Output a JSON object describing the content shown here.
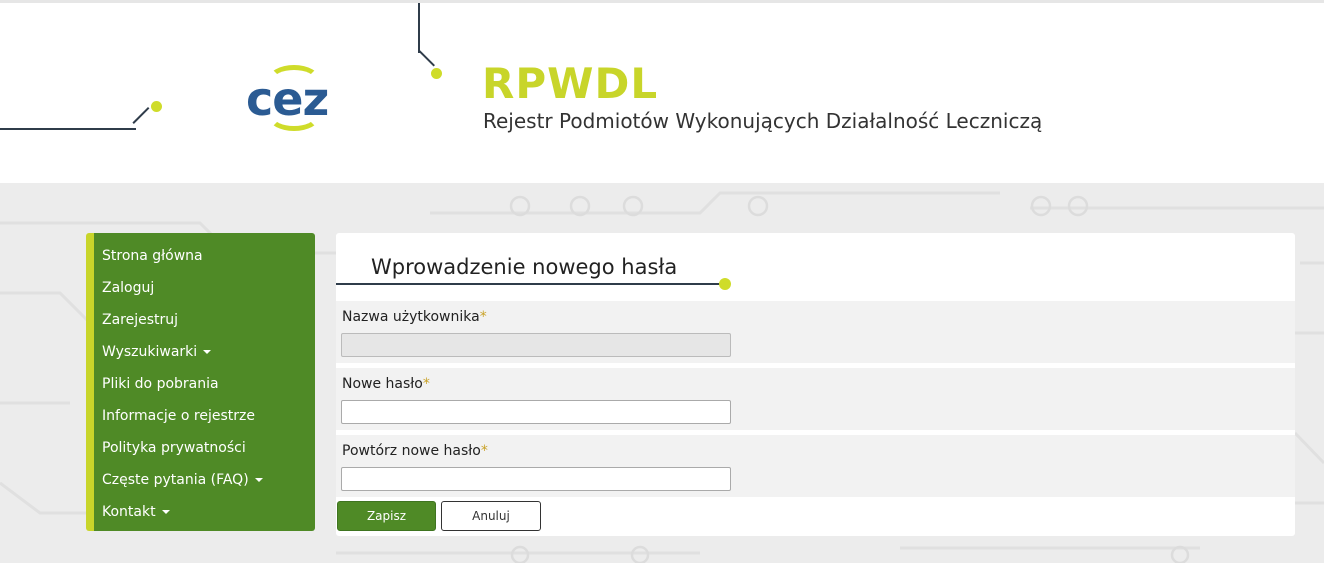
{
  "header": {
    "logo_text": "cez",
    "brand_title": "RPWDL",
    "brand_subtitle": "Rejestr Podmiotów Wykonujących Działalność Leczniczą"
  },
  "colors": {
    "accent_green": "#4f8a26",
    "accent_lime": "#c8d52a",
    "logo_blue": "#2b5b93",
    "required_star": "#c9a227"
  },
  "sidebar": {
    "items": [
      {
        "label": "Strona główna",
        "has_caret": false
      },
      {
        "label": "Zaloguj",
        "has_caret": false
      },
      {
        "label": "Zarejestruj",
        "has_caret": false
      },
      {
        "label": "Wyszukiwarki",
        "has_caret": true
      },
      {
        "label": "Pliki do pobrania",
        "has_caret": false
      },
      {
        "label": "Informacje o rejestrze",
        "has_caret": false
      },
      {
        "label": "Polityka prywatności",
        "has_caret": false
      },
      {
        "label": "Częste pytania (FAQ)",
        "has_caret": true
      },
      {
        "label": "Kontakt",
        "has_caret": true
      }
    ]
  },
  "form": {
    "title": "Wprowadzenie nowego hasła",
    "required_mark": "*",
    "fields": [
      {
        "label": "Nazwa użytkownika",
        "value": "",
        "readonly": true
      },
      {
        "label": "Nowe hasło",
        "value": "",
        "readonly": false
      },
      {
        "label": "Powtórz nowe hasło",
        "value": "",
        "readonly": false
      }
    ],
    "save_label": "Zapisz",
    "cancel_label": "Anuluj"
  }
}
